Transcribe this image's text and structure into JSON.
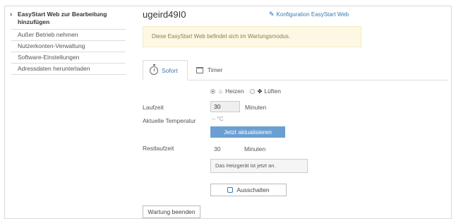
{
  "sidebar": {
    "items": [
      {
        "label": "EasyStart Web zur Bearbeitung hinzufügen",
        "active": true
      },
      {
        "label": "Außer Betrieb nehmen"
      },
      {
        "label": "Nutzerkonten-Verwaltung"
      },
      {
        "label": "Software-Einstellungen"
      },
      {
        "label": "Adressdaten herunterladen"
      }
    ]
  },
  "header": {
    "title": "ugeird49I0",
    "config_link": "Konfiguration EasyStart Web"
  },
  "alert": {
    "text": "Diese EasyStart Web befindet sich im Wartungsmodus."
  },
  "tabs": [
    {
      "label": "Sofort",
      "active": true
    },
    {
      "label": "Timer"
    }
  ],
  "mode": {
    "options": [
      {
        "label": "Heizen",
        "checked": true
      },
      {
        "label": "Lüften",
        "checked": false
      }
    ]
  },
  "form": {
    "runtime_label": "Laufzeit",
    "runtime_value": "30",
    "runtime_unit": "Minuten",
    "temp_label": "Aktuelle Temperatur",
    "temp_value": "-- °C",
    "refresh_button": "Jetzt aktualisieren",
    "remaining_label": "Restlaufzeit",
    "remaining_value": "30",
    "remaining_unit": "Minuten",
    "status_text": "Das Heizgerät ist jetzt an.",
    "off_button": "Ausschalten"
  },
  "footer": {
    "end_maintenance_button": "Wartung beenden"
  },
  "colors": {
    "accent": "#3a77b5",
    "primary_button": "#6b9fd3",
    "alert_bg": "#fcf8e3"
  }
}
